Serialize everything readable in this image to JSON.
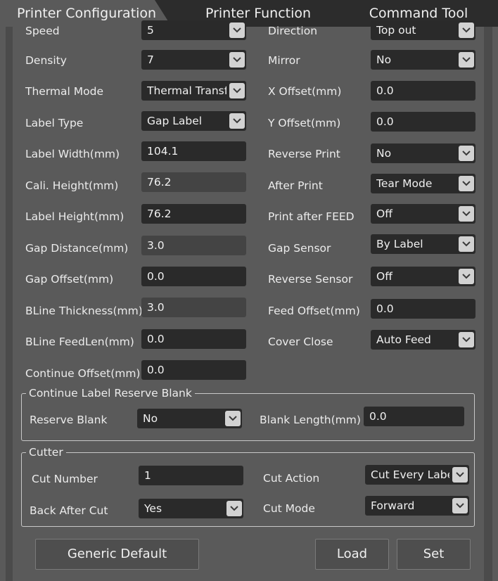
{
  "tabs": [
    "Printer Configuration",
    "Printer Function",
    "Command Tool"
  ],
  "left": {
    "speed": {
      "label": "Speed",
      "value": "5"
    },
    "density": {
      "label": "Density",
      "value": "7"
    },
    "thermal_mode": {
      "label": "Thermal Mode",
      "value": "Thermal Transfer"
    },
    "label_type": {
      "label": "Label Type",
      "value": "Gap Label"
    },
    "label_width": {
      "label": "Label Width(mm)",
      "value": "104.1"
    },
    "cali_height": {
      "label": "Cali. Height(mm)",
      "value": "76.2"
    },
    "label_height": {
      "label": "Label Height(mm)",
      "value": "76.2"
    },
    "gap_distance": {
      "label": "Gap Distance(mm)",
      "value": "3.0"
    },
    "gap_offset": {
      "label": "Gap Offset(mm)",
      "value": "0.0"
    },
    "bline_thickness": {
      "label": "BLine Thickness(mm)",
      "value": "3.0"
    },
    "bline_feedlen": {
      "label": "BLine FeedLen(mm)",
      "value": "0.0"
    },
    "continue_offset": {
      "label": "Continue Offset(mm)",
      "value": "0.0"
    }
  },
  "right": {
    "direction": {
      "label": "Direction",
      "value": "Top out"
    },
    "mirror": {
      "label": "Mirror",
      "value": "No"
    },
    "x_offset": {
      "label": "X Offset(mm)",
      "value": "0.0"
    },
    "y_offset": {
      "label": "Y Offset(mm)",
      "value": "0.0"
    },
    "reverse_print": {
      "label": "Reverse Print",
      "value": "No"
    },
    "after_print": {
      "label": "After Print",
      "value": "Tear Mode"
    },
    "print_after_feed": {
      "label": "Print after FEED",
      "value": "Off"
    },
    "gap_sensor": {
      "label": "Gap Sensor",
      "value": "By Label"
    },
    "reverse_sensor": {
      "label": "Reverse Sensor",
      "value": "Off"
    },
    "feed_offset": {
      "label": "Feed Offset(mm)",
      "value": "0.0"
    },
    "cover_close": {
      "label": "Cover Close",
      "value": "Auto Feed"
    }
  },
  "reserve_group": {
    "title": "Continue Label Reserve Blank",
    "reserve_blank": {
      "label": "Reserve Blank",
      "value": "No"
    },
    "blank_length": {
      "label": "Blank Length(mm)",
      "value": "0.0"
    }
  },
  "cutter_group": {
    "title": "Cutter",
    "cut_number": {
      "label": "Cut Number",
      "value": "1"
    },
    "cut_action": {
      "label": "Cut Action",
      "value": "Cut Every Label"
    },
    "back_after_cut": {
      "label": "Back After Cut",
      "value": "Yes"
    },
    "cut_mode": {
      "label": "Cut Mode",
      "value": "Forward"
    }
  },
  "buttons": {
    "generic_default": "Generic Default",
    "load": "Load",
    "set": "Set"
  }
}
